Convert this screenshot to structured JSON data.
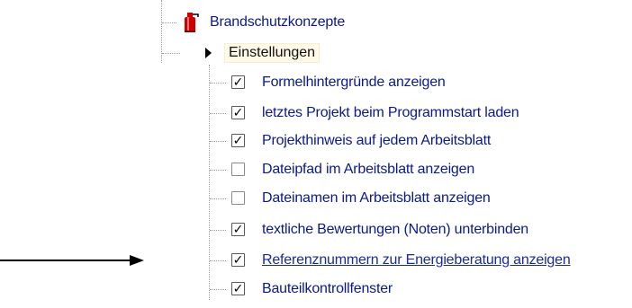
{
  "tree": {
    "root_item": {
      "label": "Brandschutzkonzepte",
      "icon": "fire-extinguisher-icon"
    },
    "settings_node": {
      "label": "Einstellungen",
      "icon": "expand-triangle-icon",
      "selected": true
    },
    "options": [
      {
        "label": "Formelhintergründe anzeigen",
        "checked": true,
        "link": false
      },
      {
        "label": "letztes Projekt beim Programmstart laden",
        "checked": true,
        "link": false
      },
      {
        "label": "Projekthinweis auf jedem Arbeitsblatt",
        "checked": true,
        "link": false
      },
      {
        "label": "Dateipfad im Arbeitsblatt anzeigen",
        "checked": false,
        "link": false
      },
      {
        "label": "Dateinamen im Arbeitsblatt anzeigen",
        "checked": false,
        "link": false
      },
      {
        "label": "textliche Bewertungen (Noten) unterbinden",
        "checked": true,
        "link": false
      },
      {
        "label": "Referenznummern zur Energieberatung anzeigen",
        "checked": true,
        "link": true
      },
      {
        "label": "Bauteilkontrollfenster",
        "checked": true,
        "link": false
      }
    ]
  },
  "colors": {
    "text": "#0a1a8a",
    "link": "#1a2a9c",
    "selection_bg": "#fff9e6",
    "extinguisher": "#cc0000"
  },
  "annotation": {
    "icon": "pointer-arrow-icon"
  }
}
